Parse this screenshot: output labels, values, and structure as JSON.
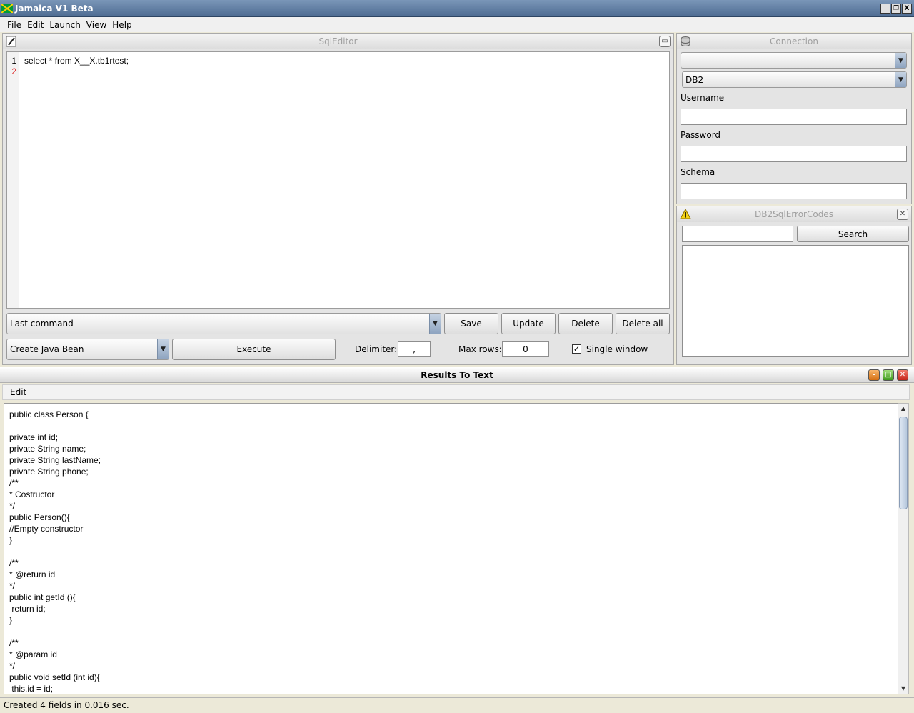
{
  "window": {
    "title": "Jamaica V1 Beta",
    "controls": [
      "_",
      "❐",
      "X"
    ]
  },
  "menu": [
    "File",
    "Edit",
    "Launch",
    "View",
    "Help"
  ],
  "sql_editor": {
    "title": "SqlEditor",
    "line_numbers": [
      "1",
      "2"
    ],
    "code": "select * from X__X.tb1rtest;",
    "last_command": "Last command",
    "save": "Save",
    "update": "Update",
    "delete": "Delete",
    "delete_all": "Delete all",
    "generator": "Create Java Bean",
    "execute": "Execute",
    "delimiter_label": "Delimiter:",
    "delimiter_value": ",",
    "max_rows_label": "Max rows:",
    "max_rows_value": "0",
    "single_window_label": "Single window",
    "single_window_checked": true
  },
  "connection": {
    "title": "Connection",
    "profile": "",
    "database_type": "DB2",
    "username_label": "Username",
    "password_label": "Password",
    "schema_label": "Schema",
    "username": "",
    "password": "",
    "schema": ""
  },
  "error_codes": {
    "title": "DB2SqlErrorCodes",
    "search_value": "",
    "search_button": "Search"
  },
  "results": {
    "title": "Results To Text",
    "menu_edit": "Edit",
    "text": "public class Person {\n\nprivate int id;\nprivate String name;\nprivate String lastName;\nprivate String phone;\n/**\n* Costructor\n*/\npublic Person(){\n//Empty constructor\n}\n\n/**\n* @return id\n*/\npublic int getId (){\n return id;\n}\n\n/**\n* @param id\n*/\npublic void setId (int id){\n this.id = id;",
    "status": "Created 4 fields in 0.016 sec."
  }
}
